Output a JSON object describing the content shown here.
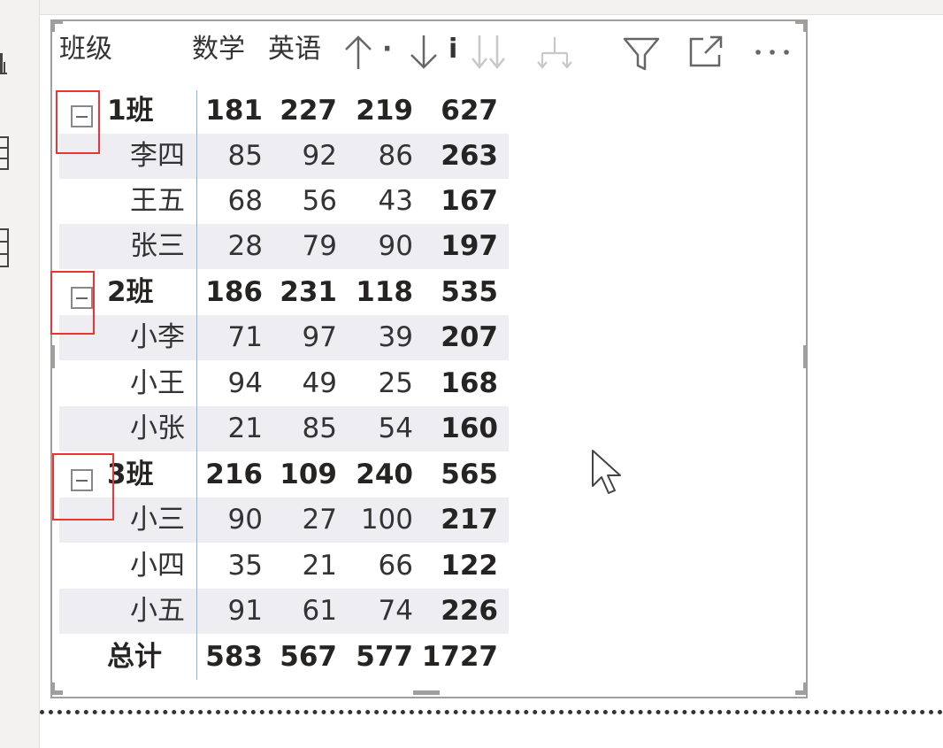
{
  "header": {
    "columns": [
      "班级",
      "数学",
      "英语"
    ],
    "partial_columns": [
      "·"
    ],
    "partial_label_3": "ⅰ"
  },
  "toolbar": {
    "icons": [
      "sort-ascending-icon",
      "sort-descending-icon",
      "drill-down-icon",
      "expand-all-icon",
      "drill-through-icon",
      "filter-icon",
      "focus-mode-icon",
      "more-options-icon"
    ]
  },
  "matrix": {
    "groups": [
      {
        "label": "1班",
        "values": [
          "181",
          "227",
          "219",
          "627"
        ],
        "rows": [
          {
            "label": "李四",
            "values": [
              "85",
              "92",
              "86",
              "263"
            ]
          },
          {
            "label": "王五",
            "values": [
              "68",
              "56",
              "43",
              "167"
            ]
          },
          {
            "label": "张三",
            "values": [
              "28",
              "79",
              "90",
              "197"
            ]
          }
        ]
      },
      {
        "label": "2班",
        "values": [
          "186",
          "231",
          "118",
          "535"
        ],
        "rows": [
          {
            "label": "小李",
            "values": [
              "71",
              "97",
              "39",
              "207"
            ]
          },
          {
            "label": "小王",
            "values": [
              "94",
              "49",
              "25",
              "168"
            ]
          },
          {
            "label": "小张",
            "values": [
              "21",
              "85",
              "54",
              "160"
            ]
          }
        ]
      },
      {
        "label": "3班",
        "values": [
          "216",
          "109",
          "240",
          "565"
        ],
        "rows": [
          {
            "label": "小三",
            "values": [
              "90",
              "27",
              "100",
              "217"
            ]
          },
          {
            "label": "小四",
            "values": [
              "35",
              "21",
              "66",
              "122"
            ]
          },
          {
            "label": "小五",
            "values": [
              "91",
              "61",
              "74",
              "226"
            ]
          }
        ]
      }
    ],
    "total": {
      "label": "总计",
      "values": [
        "583",
        "567",
        "577",
        "1727"
      ]
    }
  },
  "colors": {
    "row_shade": "#eeeef2",
    "highlight_border": "#e33333",
    "divider": "#8ab4e0"
  }
}
